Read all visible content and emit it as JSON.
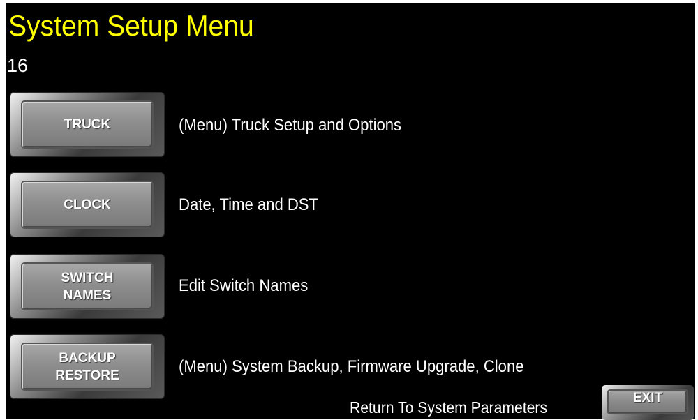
{
  "header": {
    "title": "System Setup Menu",
    "page_number": "16"
  },
  "menu": {
    "items": [
      {
        "button_label": "TRUCK",
        "description": "(Menu) Truck Setup and Options"
      },
      {
        "button_label": "CLOCK",
        "description": "Date, Time and DST"
      },
      {
        "button_label": "SWITCH\nNAMES",
        "description": "Edit Switch Names"
      },
      {
        "button_label": "BACKUP\nRESTORE",
        "description": "(Menu) System Backup, Firmware Upgrade, Clone"
      }
    ]
  },
  "footer": {
    "return_text": "Return To System Parameters",
    "exit_label": "EXIT"
  },
  "colors": {
    "background": "#000000",
    "title": "#ffff00",
    "text": "#ffffff",
    "button_face": "#8e8e8e"
  }
}
